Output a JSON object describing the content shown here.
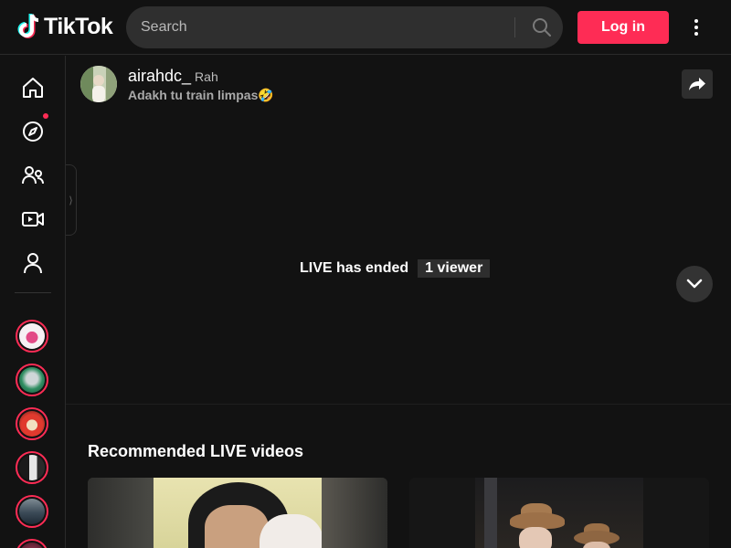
{
  "header": {
    "logo_text": "TikTok",
    "search_placeholder": "Search",
    "login_label": "Log in"
  },
  "sidebar": {
    "nav": [
      "home-icon",
      "explore-icon",
      "following-icon",
      "live-icon",
      "profile-icon"
    ],
    "explore_has_notification": true
  },
  "live": {
    "host_name": "airahdc_",
    "host_nickname": "Rah",
    "title": "Adakh tu train limpas🤣",
    "ended_text": "LIVE has ended",
    "viewer_count": "1 viewer"
  },
  "recommended": {
    "title": "Recommended LIVE videos"
  },
  "colors": {
    "accent": "#fe2c55",
    "background": "#121212"
  }
}
